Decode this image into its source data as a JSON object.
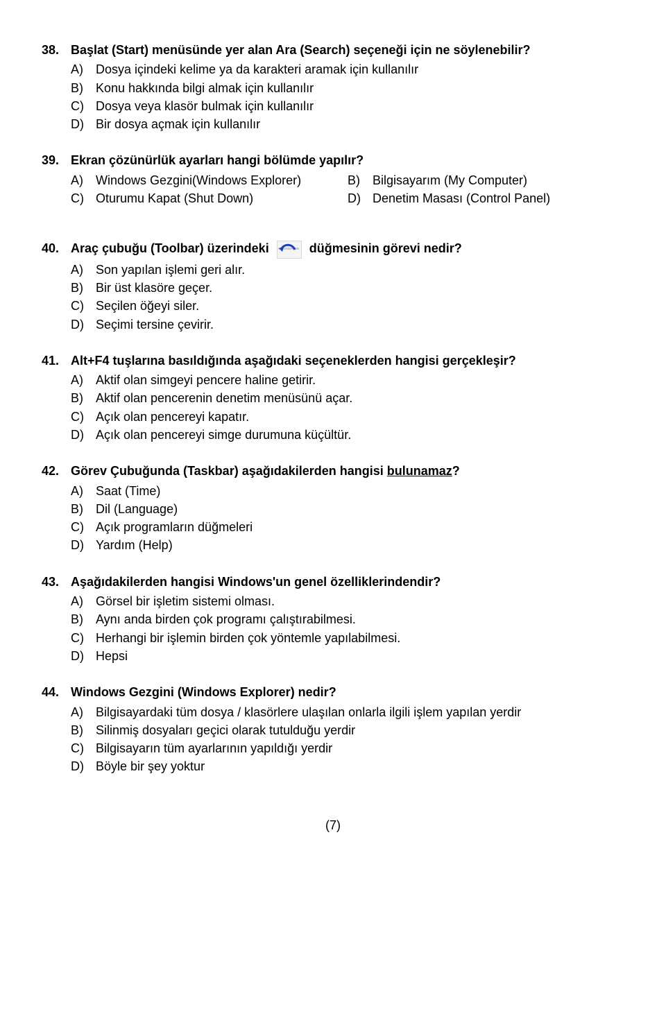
{
  "q38": {
    "num": "38.",
    "stem": "Başlat (Start) menüsünde yer alan Ara (Search) seçeneği için ne söylenebilir?",
    "A": "Dosya içindeki kelime ya da karakteri aramak için kullanılır",
    "B": "Konu hakkında bilgi almak için kullanılır",
    "C": "Dosya veya klasör bulmak için kullanılır",
    "D": "Bir dosya açmak için kullanılır"
  },
  "q39": {
    "num": "39.",
    "stem": "Ekran çözünürlük ayarları hangi bölümde yapılır?",
    "A": "Windows Gezgini(Windows Explorer)",
    "B": "Bilgisayarım (My Computer)",
    "C": "Oturumu Kapat (Shut Down)",
    "D": "Denetim Masası (Control Panel)"
  },
  "q40": {
    "num": "40.",
    "stem_pre": "Araç çubuğu (Toolbar) üzerindeki",
    "stem_post": "düğmesinin görevi nedir?",
    "A": "Son yapılan işlemi geri alır.",
    "B": "Bir üst klasöre geçer.",
    "C": "Seçilen öğeyi siler.",
    "D": "Seçimi tersine çevirir."
  },
  "q41": {
    "num": "41.",
    "stem": "Alt+F4 tuşlarına basıldığında aşağıdaki seçeneklerden hangisi gerçekleşir?",
    "A": "Aktif olan simgeyi pencere haline getirir.",
    "B": "Aktif olan pencerenin denetim menüsünü açar.",
    "C": "Açık olan pencereyi kapatır.",
    "D": "Açık olan pencereyi simge durumuna küçültür."
  },
  "q42": {
    "num": "42.",
    "stem_pre": "Görev Çubuğunda (Taskbar) aşağıdakilerden hangisi ",
    "stem_underline": "bulunamaz",
    "stem_post": "?",
    "A": "Saat (Time)",
    "B": "Dil (Language)",
    "C": "Açık programların düğmeleri",
    "D": "Yardım (Help)"
  },
  "q43": {
    "num": "43.",
    "stem": "Aşağıdakilerden hangisi Windows'un genel özelliklerindendir?",
    "A": "Görsel bir işletim sistemi olması.",
    "B": "Aynı anda birden çok programı çalıştırabilmesi.",
    "C": "Herhangi bir işlemin birden çok yöntemle yapılabilmesi.",
    "D": "Hepsi"
  },
  "q44": {
    "num": "44.",
    "stem": "Windows Gezgini (Windows Explorer) nedir?",
    "A": "Bilgisayardaki tüm dosya / klasörlere ulaşılan onlarla ilgili işlem yapılan yerdir",
    "B": "Silinmiş dosyaları geçici olarak tutulduğu yerdir",
    "C": "Bilgisayarın tüm ayarlarının yapıldığı yerdir",
    "D": "Böyle bir şey yoktur"
  },
  "page_num": "(7)",
  "labels": {
    "A": "A)",
    "B": "B)",
    "C": "C)",
    "D": "D)"
  }
}
